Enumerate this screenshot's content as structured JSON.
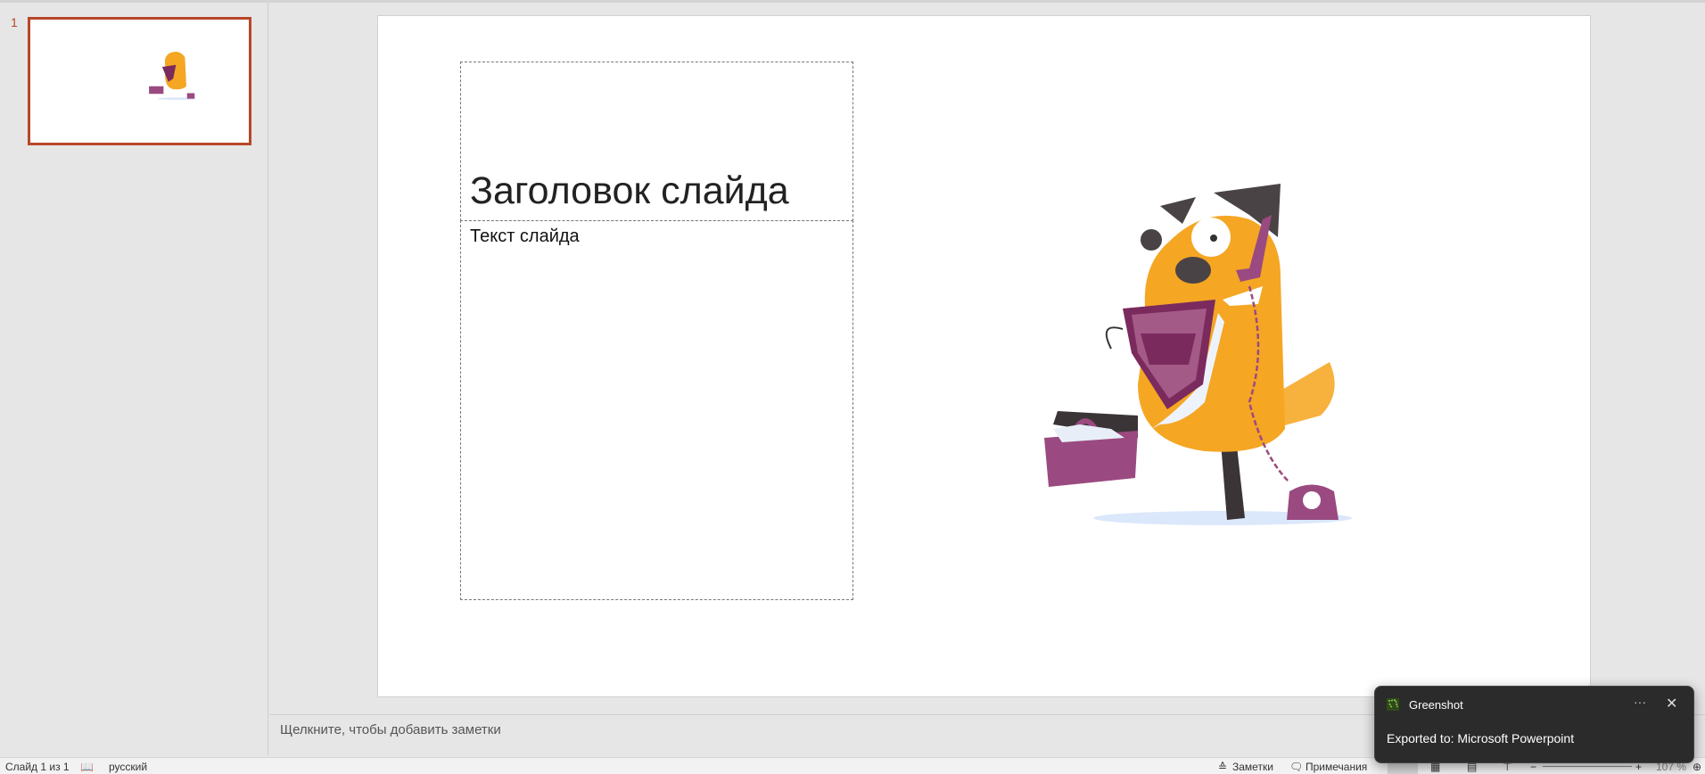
{
  "thumbnails": [
    {
      "number": "1"
    }
  ],
  "slide": {
    "title": "Заголовок слайда",
    "body": "Текст слайда"
  },
  "notes": {
    "placeholder": "Щелкните, чтобы добавить заметки"
  },
  "status": {
    "slide_count": "Слайд 1 из 1",
    "language": "русский",
    "notes_label": "Заметки",
    "comments_label": "Примечания",
    "zoom": "107 %",
    "zoom_minus": "−",
    "zoom_plus": "+"
  },
  "toast": {
    "app": "Greenshot",
    "message": "Exported to: Microsoft Powerpoint",
    "more": "···",
    "close": "✕"
  },
  "colors": {
    "accent": "#b7472a",
    "toast_bg": "#2b2b2b"
  }
}
